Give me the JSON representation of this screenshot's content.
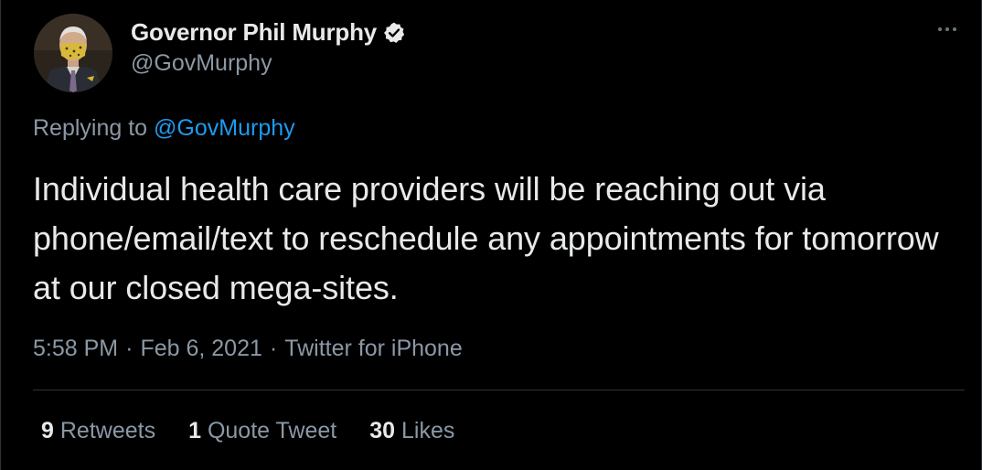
{
  "author": {
    "display_name": "Governor Phil Murphy",
    "handle": "@GovMurphy",
    "verified": true,
    "avatar_icon": "profile-photo-masked-man"
  },
  "reply": {
    "prefix": "Replying to",
    "to_handle": "@GovMurphy"
  },
  "tweet": {
    "text": "Individual health care providers will be reaching out via phone/email/text to reschedule any appointments for tomorrow at our closed mega-sites."
  },
  "meta": {
    "time": "5:58 PM",
    "date": "Feb 6, 2021",
    "source": "Twitter for iPhone",
    "separator": "·"
  },
  "stats": {
    "retweets_count": "9",
    "retweets_label": "Retweets",
    "quotes_count": "1",
    "quotes_label": "Quote Tweet",
    "likes_count": "30",
    "likes_label": "Likes"
  },
  "colors": {
    "background": "#000000",
    "link": "#1d9bf0",
    "secondary_text": "#8b98a5",
    "primary_text": "#e7e9ea"
  }
}
